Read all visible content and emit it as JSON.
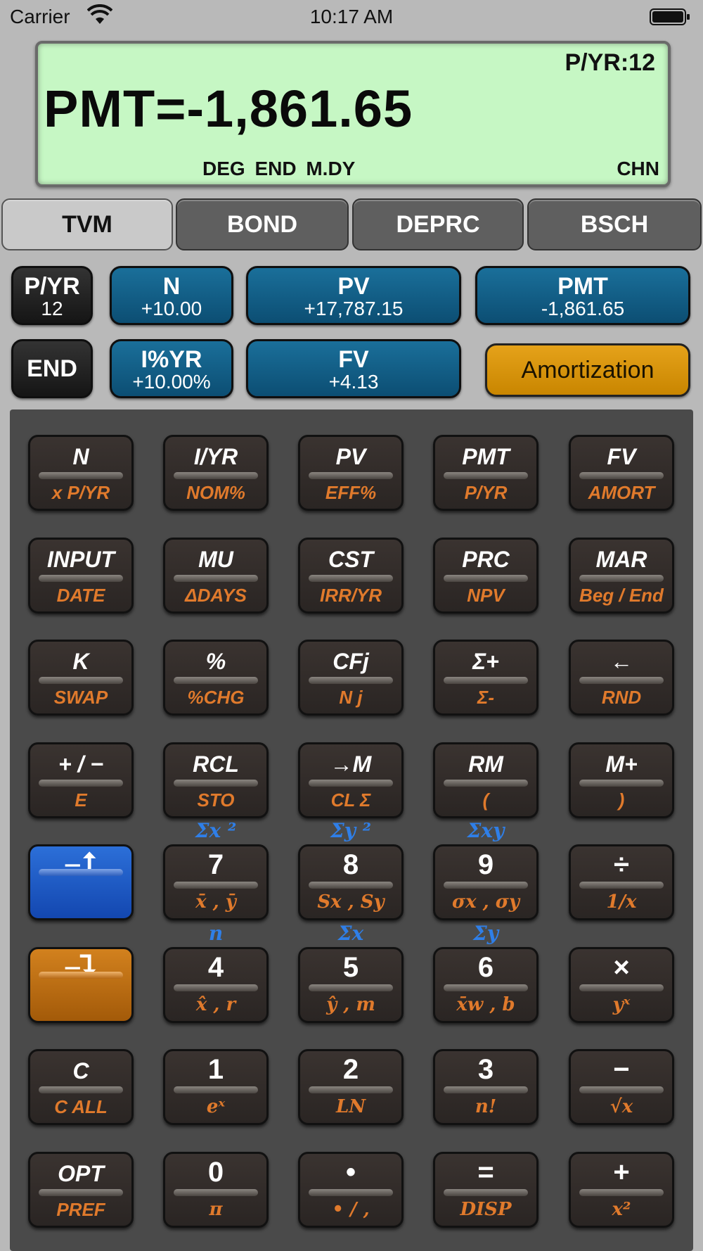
{
  "status_bar": {
    "carrier": "Carrier",
    "time": "10:17 AM"
  },
  "display": {
    "pyr": "P/YR:12",
    "main": "PMT=-1,861.65",
    "flags": "DEG END M.DY",
    "chn": "CHN"
  },
  "tabs": [
    "TVM",
    "BOND",
    "DEPRC",
    "BSCH"
  ],
  "tvm": {
    "pyr": {
      "label": "P/YR",
      "value": "12"
    },
    "n": {
      "label": "N",
      "value": "+10.00"
    },
    "pv": {
      "label": "PV",
      "value": "+17,787.15"
    },
    "pmt": {
      "label": "PMT",
      "value": "-1,861.65"
    },
    "end": {
      "label": "END"
    },
    "iyr": {
      "label": "I%YR",
      "value": "+10.00%"
    },
    "fv": {
      "label": "FV",
      "value": "+4.13"
    },
    "amort": {
      "label": "Amortization"
    }
  },
  "keys": [
    [
      {
        "top": "N",
        "bot": "x P/YR"
      },
      {
        "top": "I/YR",
        "bot": "NOM%"
      },
      {
        "top": "PV",
        "bot": "EFF%"
      },
      {
        "top": "PMT",
        "bot": "P/YR"
      },
      {
        "top": "FV",
        "bot": "AMORT"
      }
    ],
    [
      {
        "top": "INPUT",
        "bot": "DATE"
      },
      {
        "top": "MU",
        "bot": "ΔDAYS"
      },
      {
        "top": "CST",
        "bot": "IRR/YR"
      },
      {
        "top": "PRC",
        "bot": "NPV"
      },
      {
        "top": "MAR",
        "bot": "Beg / End"
      }
    ],
    [
      {
        "top": "K",
        "bot": "SWAP"
      },
      {
        "top": "%",
        "bot": "%CHG"
      },
      {
        "top": "CFj",
        "bot": "N j"
      },
      {
        "top": "Σ+",
        "bot": "Σ-"
      },
      {
        "top": "←",
        "bot": "RND"
      }
    ],
    [
      {
        "top": "+ / −",
        "bot": "E"
      },
      {
        "top": "RCL",
        "bot": "STO"
      },
      {
        "top": "→M",
        "bot": "CL Σ"
      },
      {
        "top": "RM",
        "bot": "("
      },
      {
        "top": "M+",
        "bot": ")"
      }
    ],
    [
      {
        "top": "⎯⮥",
        "bot": ""
      },
      {
        "top": "7",
        "bot": "x̄ , ȳ"
      },
      {
        "top": "8",
        "bot": "Sx , Sy"
      },
      {
        "top": "9",
        "bot": "σx , σy"
      },
      {
        "top": "÷",
        "bot": "1/x"
      }
    ],
    [
      {
        "top": "⎯⮧",
        "bot": ""
      },
      {
        "top": "4",
        "bot": "x̂ , r"
      },
      {
        "top": "5",
        "bot": "ŷ , m"
      },
      {
        "top": "6",
        "bot": "x̄w , b"
      },
      {
        "top": "×",
        "bot": "yˣ"
      }
    ],
    [
      {
        "top": "C",
        "bot": "C ALL"
      },
      {
        "top": "1",
        "bot": "eˣ"
      },
      {
        "top": "2",
        "bot": "LN"
      },
      {
        "top": "3",
        "bot": "n!"
      },
      {
        "top": "−",
        "bot": "√x"
      }
    ],
    [
      {
        "top": "OPT",
        "bot": "PREF"
      },
      {
        "top": "0",
        "bot": "π"
      },
      {
        "top": "•",
        "bot": "• / ,"
      },
      {
        "top": "=",
        "bot": "DISP"
      },
      {
        "top": "+",
        "bot": "x²"
      }
    ]
  ],
  "above_labels": {
    "r5": [
      "",
      "Σx ²",
      "Σy ²",
      "Σxy",
      ""
    ],
    "r6": [
      "",
      "n",
      "Σx",
      "Σy",
      ""
    ]
  }
}
